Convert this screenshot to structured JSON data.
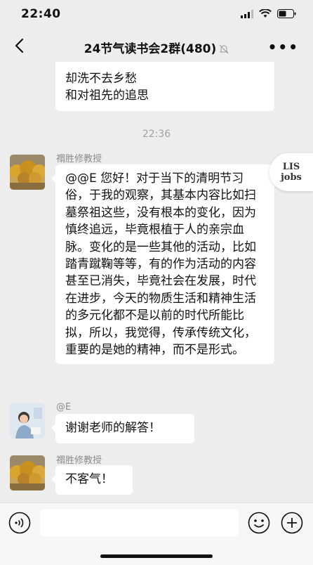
{
  "status": {
    "time": "22:40"
  },
  "nav": {
    "title": "24节气读书会2群(480)"
  },
  "messages": {
    "first_text_line1": "却洗不去乡愁",
    "first_text_line2": "和对祖先的追思",
    "timestamp": "22:36",
    "m1_sender": "禤胜修教授",
    "m1_text": "@@E 您好！对于当下的清明节习俗，于我的观察，其基本内容比如扫墓祭祖这些，没有根本的变化，因为慎终追远，毕竟根植于人的亲宗血脉。变化的是一些其他的活动，比如踏青蹴鞠等等，有的作为活动的内容甚至已消失，毕竟社会在发展，时代在进步，今天的物质生活和精神生活的多元化都不是以前的时代所能比拟，所以，我觉得，传承传统文化，重要的是她的精神，而不是形式。",
    "m2_sender": "@E",
    "m2_text": "谢谢老师的解答！",
    "m3_sender": "禤胜修教授",
    "m3_text": "不客气！"
  },
  "badge": {
    "line1": "LIS",
    "line2": "jobs"
  },
  "icons": [
    "back-icon",
    "mute-icon",
    "more-icon",
    "voice-icon",
    "emoji-icon",
    "plus-icon"
  ]
}
